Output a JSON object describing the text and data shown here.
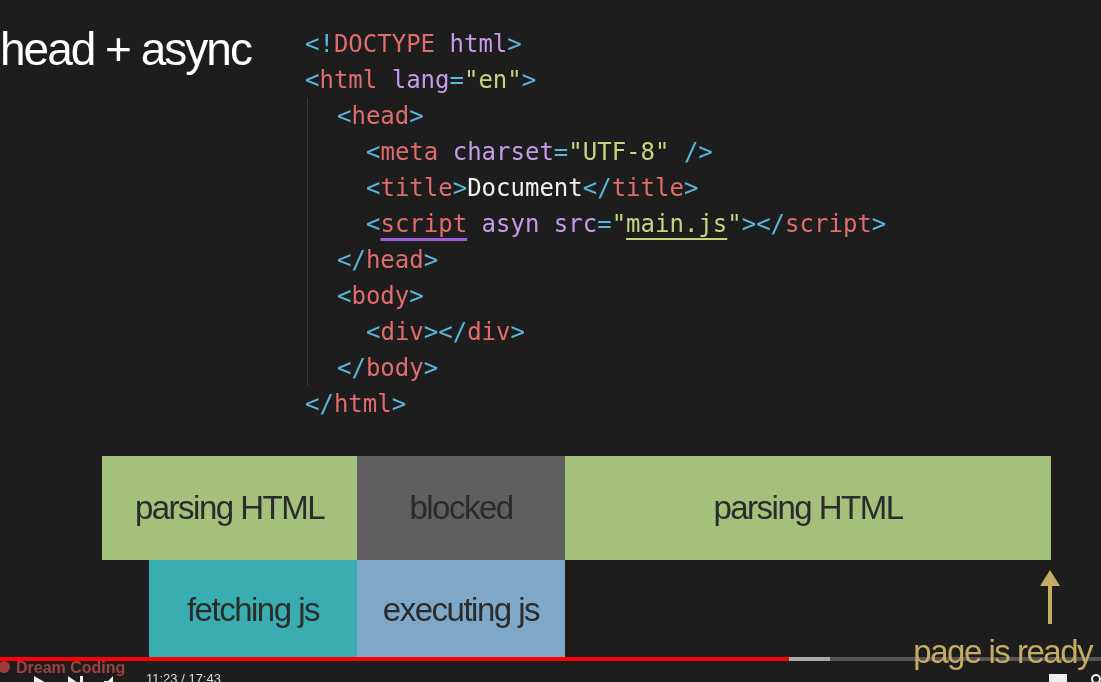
{
  "slide_title": "head + async",
  "code": [
    {
      "tokens": [
        {
          "kind": "punct",
          "text": "<!"
        },
        {
          "kind": "tag",
          "text": "DOCTYPE"
        },
        {
          "kind": "attr",
          "text": " html"
        },
        {
          "kind": "punct",
          "text": ">"
        }
      ]
    },
    {
      "tokens": [
        {
          "kind": "punct",
          "text": "<"
        },
        {
          "kind": "tag",
          "text": "html"
        },
        {
          "kind": "attr",
          "text": " lang"
        },
        {
          "kind": "punct",
          "text": "="
        },
        {
          "kind": "string",
          "text": "\"en\""
        },
        {
          "kind": "punct",
          "text": ">"
        }
      ],
      "children": [
        {
          "tokens": [
            {
              "kind": "punct",
              "text": "<"
            },
            {
              "kind": "tag",
              "text": "head"
            },
            {
              "kind": "punct",
              "text": ">"
            }
          ],
          "children": [
            {
              "tokens": [
                {
                  "kind": "punct",
                  "text": "<"
                },
                {
                  "kind": "tag",
                  "text": "meta"
                },
                {
                  "kind": "attr",
                  "text": " charset"
                },
                {
                  "kind": "punct",
                  "text": "="
                },
                {
                  "kind": "string",
                  "text": "\"UTF-8\""
                },
                {
                  "kind": "punct",
                  "text": " />"
                }
              ]
            },
            {
              "tokens": [
                {
                  "kind": "punct",
                  "text": "<"
                },
                {
                  "kind": "tag",
                  "text": "title"
                },
                {
                  "kind": "punct",
                  "text": ">"
                },
                {
                  "kind": "text",
                  "text": "Document"
                },
                {
                  "kind": "punct",
                  "text": "</"
                },
                {
                  "kind": "tag",
                  "text": "title"
                },
                {
                  "kind": "punct",
                  "text": ">"
                }
              ]
            },
            {
              "tokens": [
                {
                  "kind": "punct",
                  "text": "<"
                },
                {
                  "kind": "tag",
                  "text": "script",
                  "squiggle": true
                },
                {
                  "kind": "attr",
                  "text": " asyn src"
                },
                {
                  "kind": "punct",
                  "text": "="
                },
                {
                  "kind": "string",
                  "text": "\""
                },
                {
                  "kind": "string",
                  "text": "main.js",
                  "underline": true
                },
                {
                  "kind": "string",
                  "text": "\""
                },
                {
                  "kind": "punct",
                  "text": "></"
                },
                {
                  "kind": "tag",
                  "text": "script"
                },
                {
                  "kind": "punct",
                  "text": ">"
                }
              ]
            }
          ]
        },
        {
          "tokens": [
            {
              "kind": "punct",
              "text": "</"
            },
            {
              "kind": "tag",
              "text": "head"
            },
            {
              "kind": "punct",
              "text": ">"
            }
          ]
        },
        {
          "tokens": [
            {
              "kind": "punct",
              "text": "<"
            },
            {
              "kind": "tag",
              "text": "body"
            },
            {
              "kind": "punct",
              "text": ">"
            }
          ],
          "children": [
            {
              "tokens": [
                {
                  "kind": "punct",
                  "text": "<"
                },
                {
                  "kind": "tag",
                  "text": "div"
                },
                {
                  "kind": "punct",
                  "text": "></"
                },
                {
                  "kind": "tag",
                  "text": "div"
                },
                {
                  "kind": "punct",
                  "text": ">"
                }
              ]
            }
          ]
        },
        {
          "tokens": [
            {
              "kind": "punct",
              "text": "</"
            },
            {
              "kind": "tag",
              "text": "body"
            },
            {
              "kind": "punct",
              "text": ">"
            }
          ]
        }
      ]
    },
    {
      "tokens": [
        {
          "kind": "punct",
          "text": "</"
        },
        {
          "kind": "tag",
          "text": "html"
        },
        {
          "kind": "punct",
          "text": ">"
        }
      ]
    }
  ],
  "timeline": [
    {
      "segments": [
        {
          "label": "parsing HTML",
          "color": "#a3c17b"
        },
        {
          "label": "blocked",
          "color": "#5f5f5f"
        },
        {
          "label": "parsing HTML",
          "color": "#a3c17b"
        }
      ]
    },
    {
      "segments": [
        {
          "label": "fetching js",
          "color": "#3aadb0"
        },
        {
          "label": "executing js",
          "color": "#7fa8c8"
        }
      ]
    }
  ],
  "milestone": "page is ready",
  "player": {
    "channel": "Dream Coding",
    "time": "11:23 / 17:43",
    "progress": {
      "level": 0.717
    },
    "buffered": {
      "level": 0.754
    }
  }
}
